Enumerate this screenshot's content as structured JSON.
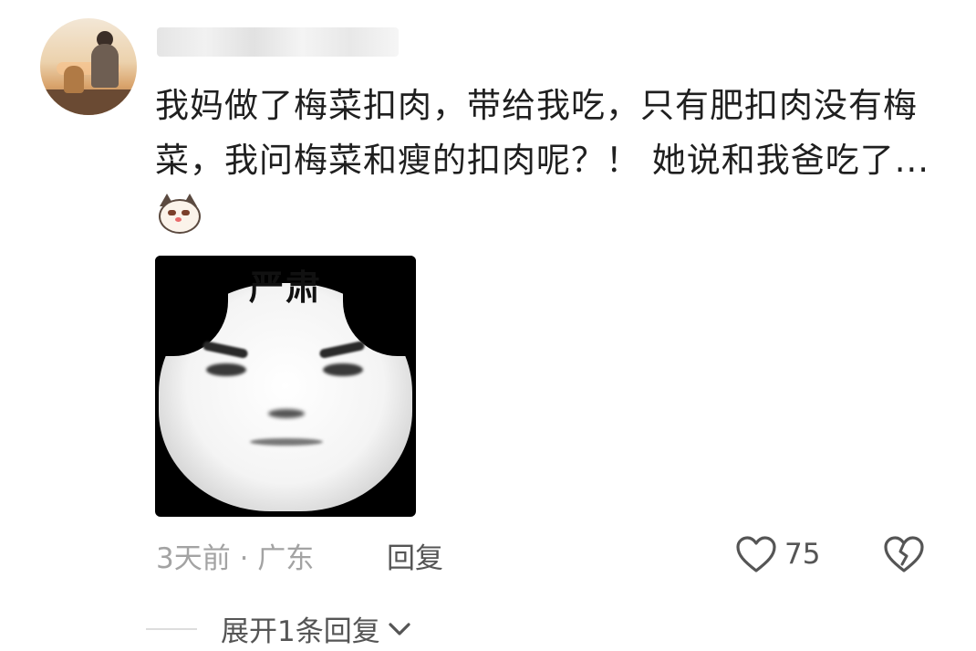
{
  "comment": {
    "text": "我妈做了梅菜扣肉，带给我吃，只有肥扣肉没有梅菜，我问梅菜和瘦的扣肉呢？！ 她说和我爸吃了...",
    "emoji": "cat-smirk-icon",
    "image": {
      "caption": "严肃"
    },
    "meta": "3天前 · 广东",
    "reply_label": "回复",
    "like_count": "75",
    "expand_label": "展开1条回复"
  },
  "colors": {
    "text": "#1f1f1f",
    "meta": "#a3a3a3",
    "action": "#555555"
  }
}
